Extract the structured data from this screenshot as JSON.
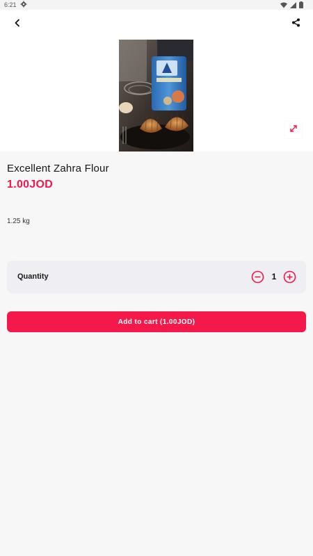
{
  "status_bar": {
    "time": "6:21"
  },
  "product": {
    "name": "Excellent Zahra Flour",
    "price": "1.00JOD",
    "size": "1.25 kg"
  },
  "quantity": {
    "label": "Quantity",
    "value": "1"
  },
  "cart_button": {
    "label": "Add to cart (1.00JOD)"
  },
  "colors": {
    "accent": "#f5194b",
    "background": "#f7f7f7",
    "card": "#efeef3"
  },
  "icons": [
    "back-arrow-icon",
    "share-icon",
    "expand-icon",
    "minus-circle-icon",
    "plus-circle-icon",
    "settings-icon",
    "wifi-icon",
    "signal-icon",
    "battery-icon"
  ]
}
